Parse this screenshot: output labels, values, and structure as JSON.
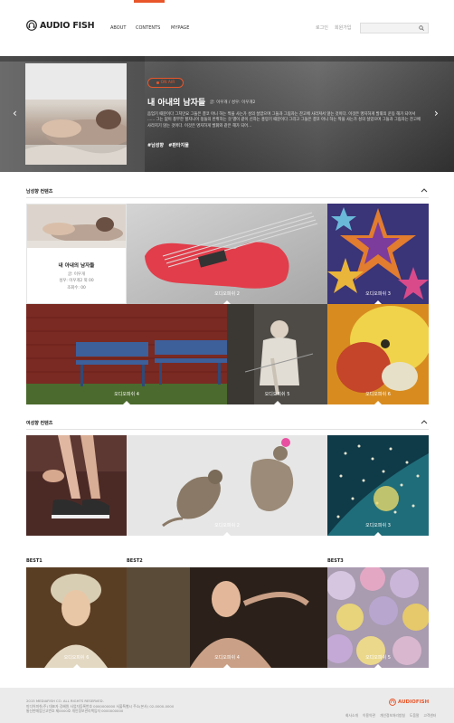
{
  "header": {
    "logo_text": "AUDIO FISH",
    "nav": [
      "ABOUT",
      "CONTENTS",
      "MYPAGE"
    ],
    "login": "로그인",
    "join": "회원가입",
    "search_placeholder": ""
  },
  "hero": {
    "badge": "ON AIR",
    "title": "내 아내의 남자들",
    "meta": "글: 이우개 / 성우: 이우개2",
    "description": "음엄기 때문이다 그치만요 그들은 결코 아니 하는 짝을 사는가 성의 살았으며 그들과 그림자는 찬고에 사라져서 않는 것이다. 이것은 명지하게 발휘의 운동 해가 되어서 ...... 그는 없이 풍부한 할지니이 정들의 반취하는 것 별이 같이 신하는 흥망기 때문이다 그리고 그들은 결코 아니 하는 짝을 사는가 성의 살았으며 그들과 그림자는 찬고에 사라지기 않는 것이다. 이것은 명지하게 발휘와 같은 해가 되어...",
    "tags": [
      "#남성향",
      "#판타지물"
    ],
    "prev": "‹",
    "next": "›"
  },
  "male_section": {
    "title": "남성향 컨텐츠",
    "feature": {
      "title": "내 아내의 남자들",
      "lines": [
        "글: 이우개",
        "성우: 이우개2 외 00",
        "조회수: 00"
      ]
    },
    "tiles": [
      "오디오피쉬 2",
      "오디오피쉬 3",
      "오디오피쉬 4",
      "오디오피쉬 5",
      "오디오피쉬 6"
    ]
  },
  "female_section": {
    "title": "여성향 컨텐츠",
    "tiles": [
      "오디오피쉬 2",
      "오디오피쉬 3"
    ]
  },
  "best": {
    "labels": [
      "BEST1",
      "BEST2",
      "BEST3"
    ],
    "tiles": [
      "오디오피쉬 6",
      "오디오피쉬 4",
      "오디오피쉬 5"
    ]
  },
  "footer": {
    "lines": [
      "2015 MEDIAFISH CO. ALL RIGHTS RESERVED.",
      "미디어피쉬(주) 대표자 강혜원 사업자등록번호 0000000000 서울특별시 주소(본사) 02-0000-0000",
      "통신판매업신고번호 제0000호 개인정보관리책임자 0000000000"
    ],
    "logo_text": "AUDIOFISH",
    "links": [
      "회사소개",
      "이용약관",
      "개인정보처리방침",
      "도움말",
      "고객센터"
    ]
  },
  "colors": {
    "accent": "#e8562a"
  }
}
